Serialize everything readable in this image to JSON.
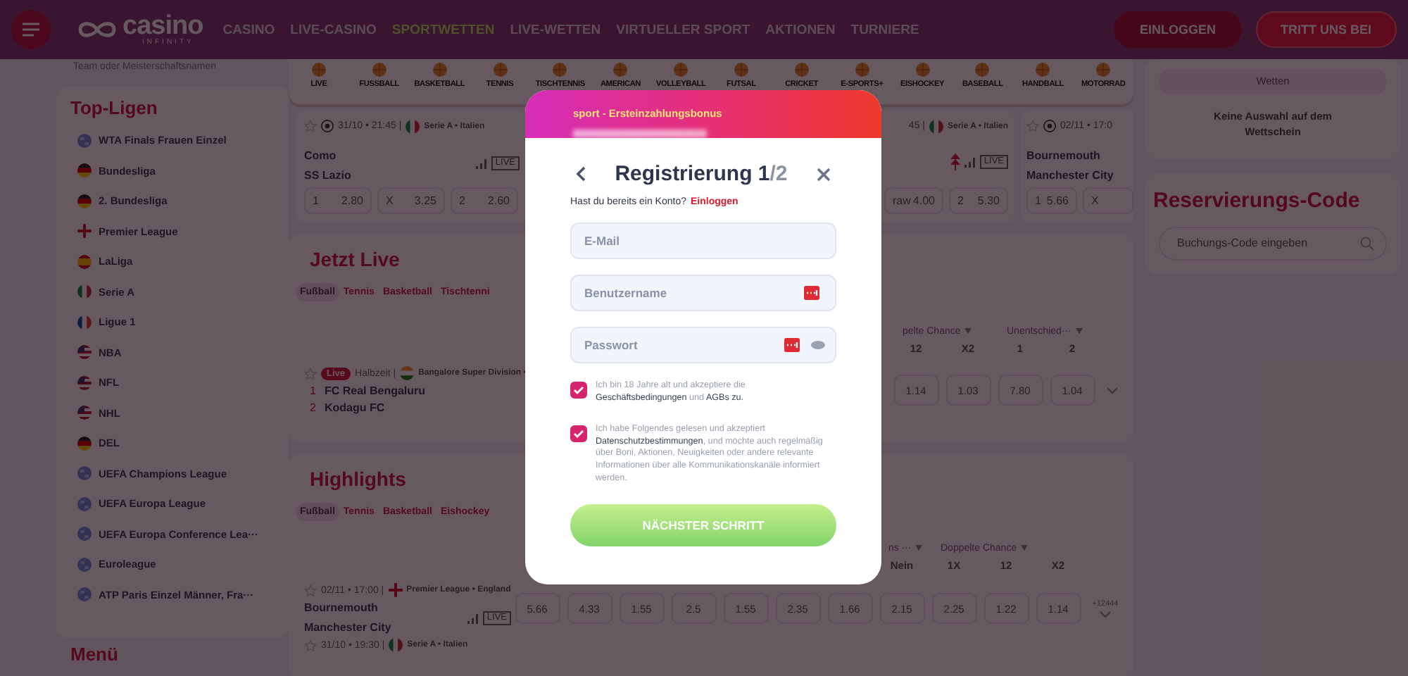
{
  "header": {
    "logo": {
      "name": "casino",
      "tagline": "INFINITY"
    },
    "nav": [
      {
        "label": "CASINO",
        "selected": false
      },
      {
        "label": "LIVE-CASINO",
        "selected": false
      },
      {
        "label": "SPORTWETTEN",
        "selected": true
      },
      {
        "label": "LIVE-WETTEN",
        "selected": false
      },
      {
        "label": "VIRTUELLER SPORT",
        "selected": false
      },
      {
        "label": "AKTIONEN",
        "selected": false
      },
      {
        "label": "TURNIERE",
        "selected": false
      }
    ],
    "buttons": [
      {
        "label": "EINLOGGEN",
        "kind": "outline"
      },
      {
        "label": "TRITT UNS BEI",
        "kind": "primary"
      }
    ]
  },
  "sidebar": {
    "search": {
      "placeholder": "Team oder Meisterschaftsnamen"
    },
    "title": "Top-Ligen",
    "items": [
      {
        "label": "WTA Finals Frauen Einzel",
        "kind": "world"
      },
      {
        "label": "Bundesliga",
        "kind": "de"
      },
      {
        "label": "2. Bundesliga",
        "kind": "de"
      },
      {
        "label": "Premier League",
        "kind": "en"
      },
      {
        "label": "LaLiga",
        "kind": "es"
      },
      {
        "label": "Serie A",
        "kind": "it"
      },
      {
        "label": "Ligue 1",
        "kind": "fr"
      },
      {
        "label": "NBA",
        "kind": "us"
      },
      {
        "label": "NFL",
        "kind": "us"
      },
      {
        "label": "NHL",
        "kind": "us"
      },
      {
        "label": "DEL",
        "kind": "de"
      },
      {
        "label": "UEFA Champions League",
        "kind": "world"
      },
      {
        "label": "UEFA Europa League",
        "kind": "world"
      },
      {
        "label": "UEFA Europa Conference Lea···",
        "kind": "world"
      },
      {
        "label": "Euroleague",
        "kind": "world"
      },
      {
        "label": "ATP Paris Einzel Männer, Fra···",
        "kind": "world"
      }
    ],
    "menu_title": "Menü"
  },
  "sports": [
    "LIVE",
    "FUSSBALL",
    "BASKETBALL",
    "TENNIS",
    "TISCHTENNIS",
    "AMERICAN",
    "VOLLEYBALL",
    "FUTSAL",
    "CRICKET",
    "E-SPORTS+",
    "EISHOCKEY",
    "BASEBALL",
    "HANDBALL",
    "MOTORRAD"
  ],
  "featured": [
    {
      "meta": "31/10 • 21:45 |",
      "league": {
        "name": "Serie A • Italien",
        "kind": "it"
      },
      "teams": [
        "Como",
        "SS Lazio"
      ],
      "live_tag": "LIVE",
      "odds": [
        {
          "label": "1",
          "value": "2.80"
        },
        {
          "label": "X",
          "value": "3.25"
        },
        {
          "label": "2",
          "value": "2.60"
        }
      ]
    },
    {
      "meta": "45 |",
      "league": {
        "name": "Serie A • Italien",
        "kind": "it"
      },
      "live_tag": "LIVE",
      "odds": [
        {
          "label": "raw",
          "value": "4.00"
        },
        {
          "label": "2",
          "value": "5.30"
        }
      ]
    },
    {
      "meta": "02/11 • 17:0",
      "teams": [
        "Bournemouth",
        "Manchester City"
      ],
      "odds": [
        {
          "label": "1",
          "value": "5.66"
        },
        {
          "label": "X"
        }
      ]
    }
  ],
  "live": {
    "title": "Jetzt Live",
    "tabs": [
      {
        "label": "Fußball",
        "selected": true
      },
      {
        "label": "Tennis",
        "selected": false
      },
      {
        "label": "Basketball",
        "selected": false
      },
      {
        "label": "Tischtenni",
        "selected": false
      }
    ],
    "markets": [
      {
        "title": "pelte Chance",
        "outcomes": [
          "12",
          "X2"
        ]
      },
      {
        "title": "Unentschied···",
        "outcomes": [
          "1",
          "2"
        ]
      }
    ],
    "match": {
      "badge": "Live",
      "status": "Halbzeit |",
      "league": {
        "name": "Bangalore Super Division •",
        "kind": "in"
      },
      "teams": [
        {
          "rank": "1",
          "name": "FC Real Bengaluru"
        },
        {
          "rank": "2",
          "name": "Kodagu FC"
        }
      ],
      "odds": [
        "1.14",
        "1.03",
        "7.80",
        "1.04"
      ]
    }
  },
  "highlights": {
    "title": "Highlights",
    "tabs": [
      {
        "label": "Fußball",
        "selected": true
      },
      {
        "label": "Tennis",
        "selected": false
      },
      {
        "label": "Basketball",
        "selected": false
      },
      {
        "label": "Eishockey",
        "selected": false
      }
    ],
    "markets": [
      {
        "title": "ns ···",
        "outcomes": [
          "Nein"
        ]
      },
      {
        "title": "Doppelte Chance",
        "outcomes": [
          "1X",
          "12",
          "X2"
        ]
      }
    ],
    "matches": [
      {
        "meta": "02/11 • 17:00 |",
        "league": {
          "name": "Premier League • England",
          "kind": "en"
        },
        "teams": [
          "Bournemouth",
          "Manchester City"
        ],
        "live_tag": "LIVE",
        "odds": [
          "5.66",
          "4.33",
          "1.55",
          "2.5",
          "1.55",
          "2.35",
          "1.66",
          "2.15",
          "2.25",
          "1.22",
          "1.14"
        ],
        "more": "+12444"
      },
      {
        "meta": "31/10 • 19:30 |",
        "league": {
          "name": "Serie A • Italien",
          "kind": "it"
        }
      }
    ]
  },
  "betslip": {
    "button": "Wetten",
    "empty_text": "Keine Auswahl auf dem Wettschein"
  },
  "booking": {
    "title": "Reservierungs-Code",
    "placeholder": "Buchungs-Code eingeben"
  },
  "dialog": {
    "banner": "sport - Ersteinzahlungsbonus",
    "title": "Registrierung 1",
    "step_total": "/2",
    "login_prompt": "Hast du bereits ein Konto?",
    "login_link": "Einloggen",
    "fields": [
      {
        "placeholder": "E-Mail",
        "kind": "email"
      },
      {
        "placeholder": "Benutzername",
        "kind": "username"
      },
      {
        "placeholder": "Passwort",
        "kind": "password"
      }
    ],
    "consents": [
      {
        "text": "Ich bin 18 Jahre alt und akzeptiere die **Geschäftsbedingungen** und **AGBs zu.**",
        "checked": true
      },
      {
        "text": "Ich habe Folgendes gelesen und akzeptiert **Datenschutzbestimmungen**, und möchte auch regelmäßig über Boni, Aktionen, Neuigkeiten oder andere relevante Informationen über alle Kommunikationskanäle informiert werden.",
        "checked": true
      }
    ],
    "submit": "NÄCHSTER SCHRITT"
  }
}
